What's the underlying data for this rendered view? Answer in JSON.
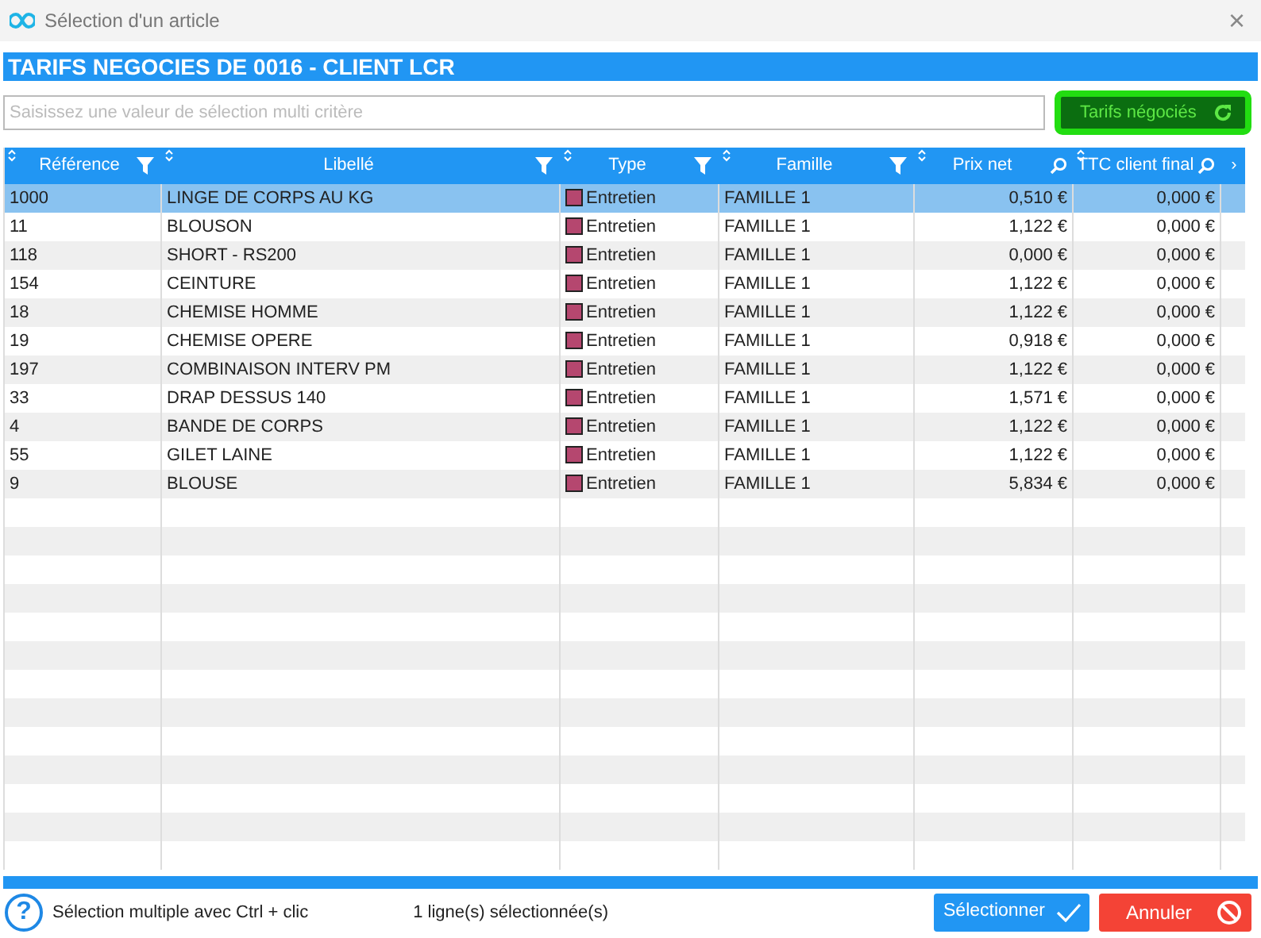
{
  "window": {
    "title": "Sélection d'un article",
    "close": "×"
  },
  "header": {
    "title": "TARIFS NEGOCIES DE 0016 - CLIENT LCR"
  },
  "search": {
    "placeholder": "Saisissez une valeur de sélection multi critère"
  },
  "toggle_button": {
    "label": "Tarifs négociés"
  },
  "table": {
    "columns": [
      {
        "label": "Référence",
        "kind": "filter"
      },
      {
        "label": "Libellé",
        "kind": "filter"
      },
      {
        "label": "Type",
        "kind": "filter"
      },
      {
        "label": "Famille",
        "kind": "filter"
      },
      {
        "label": "Prix net",
        "kind": "search"
      },
      {
        "label": "TTC client final",
        "kind": "search"
      }
    ],
    "more": "›",
    "rows": [
      {
        "cells": [
          "1000",
          "LINGE DE CORPS AU KG",
          "Entretien",
          "FAMILLE 1",
          "0,510 €",
          "0,000 €"
        ],
        "color": "#b5476f",
        "selected": true
      },
      {
        "cells": [
          "11",
          "BLOUSON",
          "Entretien",
          "FAMILLE 1",
          "1,122 €",
          "0,000 €"
        ],
        "color": "#b5476f",
        "selected": false
      },
      {
        "cells": [
          "118",
          "SHORT - RS200",
          "Entretien",
          "FAMILLE 1",
          "0,000 €",
          "0,000 €"
        ],
        "color": "#b5476f",
        "selected": false
      },
      {
        "cells": [
          "154",
          "CEINTURE",
          "Entretien",
          "FAMILLE 1",
          "1,122 €",
          "0,000 €"
        ],
        "color": "#b5476f",
        "selected": false
      },
      {
        "cells": [
          "18",
          "CHEMISE HOMME",
          "Entretien",
          "FAMILLE 1",
          "1,122 €",
          "0,000 €"
        ],
        "color": "#b5476f",
        "selected": false
      },
      {
        "cells": [
          "19",
          "CHEMISE OPERE",
          "Entretien",
          "FAMILLE 1",
          "0,918 €",
          "0,000 €"
        ],
        "color": "#b5476f",
        "selected": false
      },
      {
        "cells": [
          "197",
          "COMBINAISON INTERV PM",
          "Entretien",
          "FAMILLE 1",
          "1,122 €",
          "0,000 €"
        ],
        "color": "#b5476f",
        "selected": false
      },
      {
        "cells": [
          "33",
          "DRAP DESSUS 140",
          "Entretien",
          "FAMILLE 1",
          "1,571 €",
          "0,000 €"
        ],
        "color": "#b5476f",
        "selected": false
      },
      {
        "cells": [
          "4",
          "BANDE DE CORPS",
          "Entretien",
          "FAMILLE 1",
          "1,122 €",
          "0,000 €"
        ],
        "color": "#b5476f",
        "selected": false
      },
      {
        "cells": [
          "55",
          "GILET LAINE",
          "Entretien",
          "FAMILLE 1",
          "1,122 €",
          "0,000 €"
        ],
        "color": "#b5476f",
        "selected": false
      },
      {
        "cells": [
          "9",
          "BLOUSE",
          "Entretien",
          "FAMILLE 1",
          "5,834 €",
          "0,000 €"
        ],
        "color": "#b5476f",
        "selected": false
      }
    ]
  },
  "footer": {
    "help_text": "Sélection multiple avec Ctrl + clic",
    "help_icon": "?",
    "status": "1 ligne(s) sélectionnée(s)",
    "select_button": "Sélectionner",
    "cancel_button": "Annuler"
  }
}
